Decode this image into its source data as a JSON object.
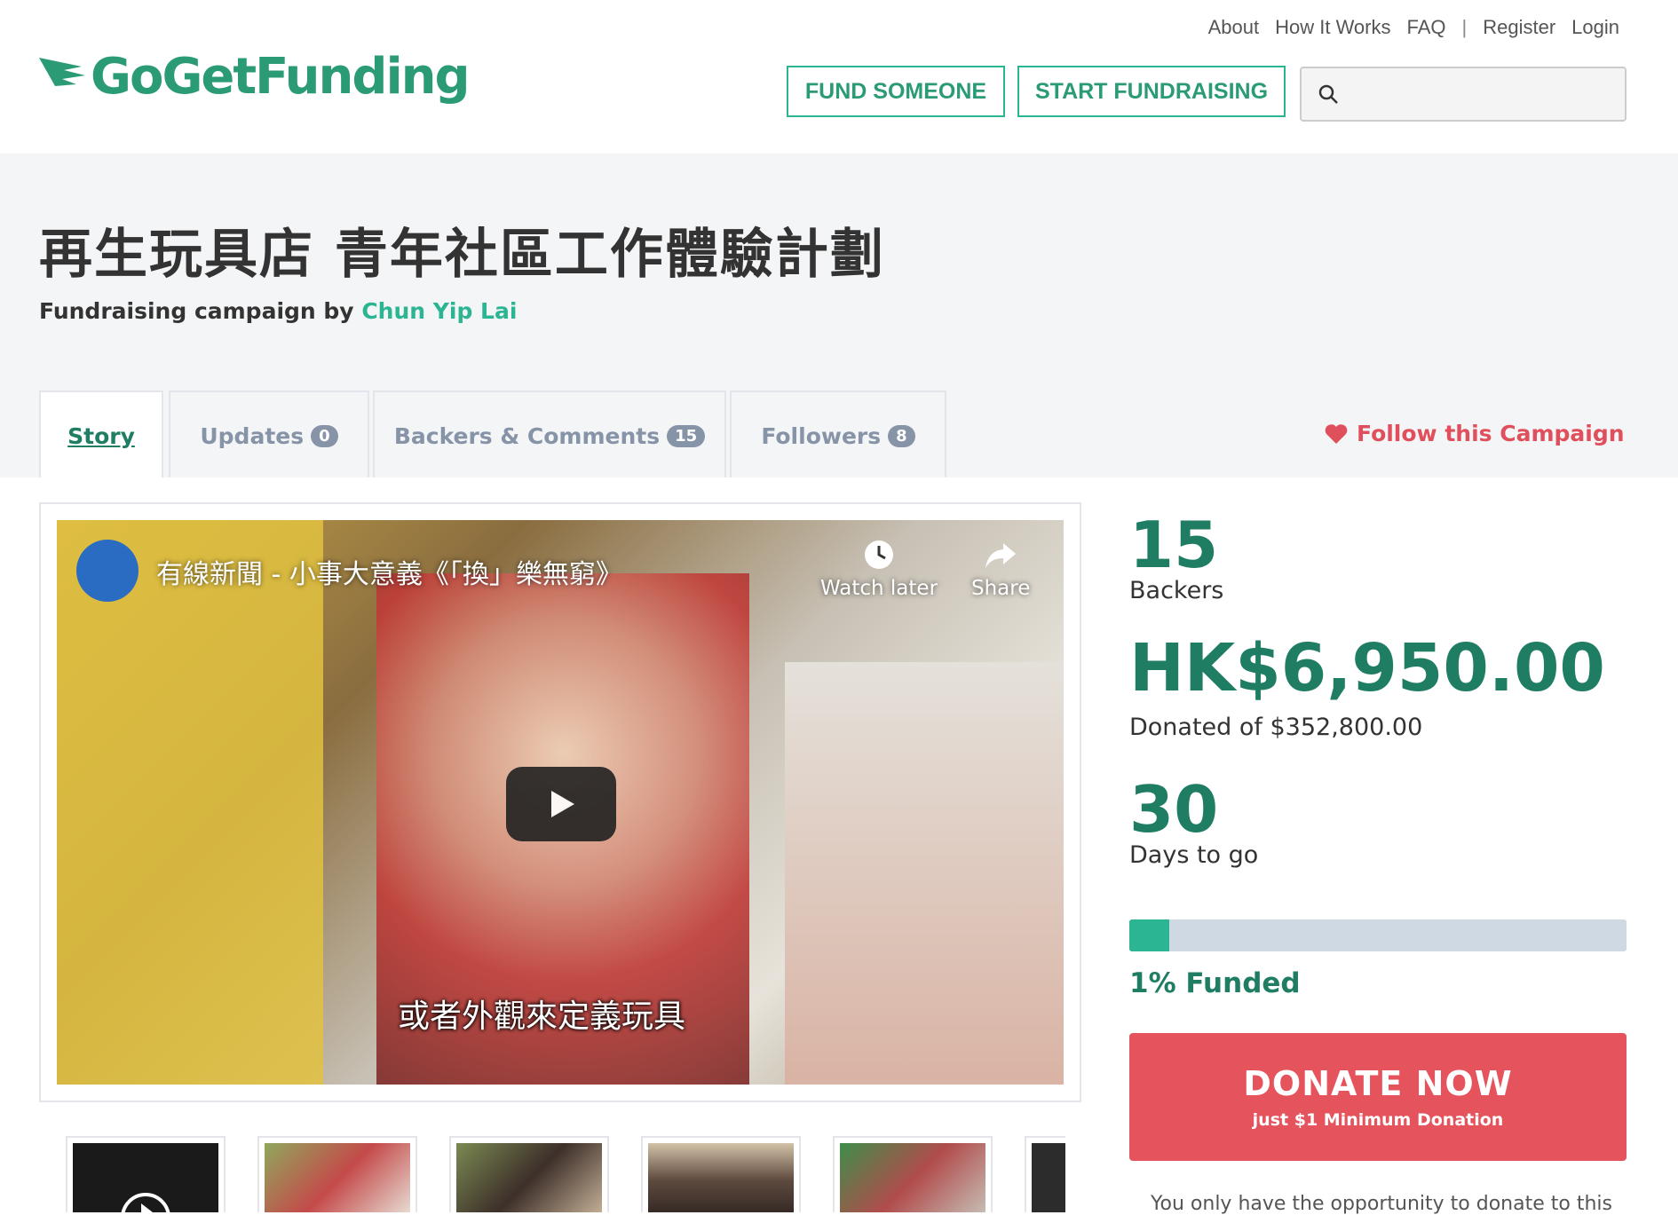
{
  "brand": {
    "name": "GoGetFunding",
    "color": "#2b9b76"
  },
  "nav": {
    "about": "About",
    "how_it_works": "How It Works",
    "faq": "FAQ",
    "separator": "|",
    "register": "Register",
    "login": "Login",
    "fund_someone": "FUND SOMEONE",
    "start_fundraising": "START FUNDRAISING",
    "search_placeholder": ""
  },
  "campaign": {
    "title": "再生玩具店 青年社區工作體驗計劃",
    "by_label": "Fundraising campaign by",
    "owner": "Chun Yip Lai"
  },
  "tabs": [
    {
      "label": "Story",
      "count": null,
      "active": true
    },
    {
      "label": "Updates",
      "count": "0"
    },
    {
      "label": "Backers & Comments",
      "count": "15"
    },
    {
      "label": "Followers",
      "count": "8"
    }
  ],
  "follow": {
    "label": "Follow this Campaign",
    "icon": "heart-icon"
  },
  "video": {
    "title": "有線新聞 - 小事大意義《「換」樂無窮》",
    "watch_later": "Watch later",
    "share": "Share",
    "caption": "或者外觀來定義玩具",
    "channel_watermark": "有線新聞"
  },
  "stats": {
    "backers_count": "15",
    "backers_label": "Backers",
    "raised": "HK$6,950.00",
    "raised_label": "Donated of $352,800.00",
    "days": "30",
    "days_label": "Days to go",
    "funded_percent": 1,
    "funded_label": "1% Funded"
  },
  "donate": {
    "label": "DONATE NOW",
    "sublabel": "just $1 Minimum Donation"
  },
  "note": "You only have the opportunity to donate to this",
  "colors": {
    "accent": "#2bb592",
    "accent_dark": "#1f7d63",
    "donate": "#e5535d",
    "follow": "#e0505c",
    "progress_track": "#cfd9e4"
  }
}
